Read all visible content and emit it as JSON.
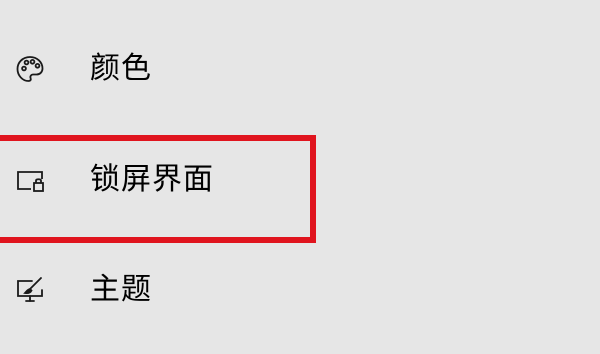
{
  "nav": {
    "items": [
      {
        "label": "颜色",
        "icon": "palette-icon"
      },
      {
        "label": "锁屏界面",
        "icon": "lock-screen-icon"
      },
      {
        "label": "主题",
        "icon": "themes-brush-icon"
      }
    ]
  },
  "highlight": {
    "target": "锁屏界面",
    "color": "#e0141e"
  },
  "colors": {
    "background": "#e6e6e6",
    "text": "#000000",
    "highlight_border": "#e0141e"
  }
}
